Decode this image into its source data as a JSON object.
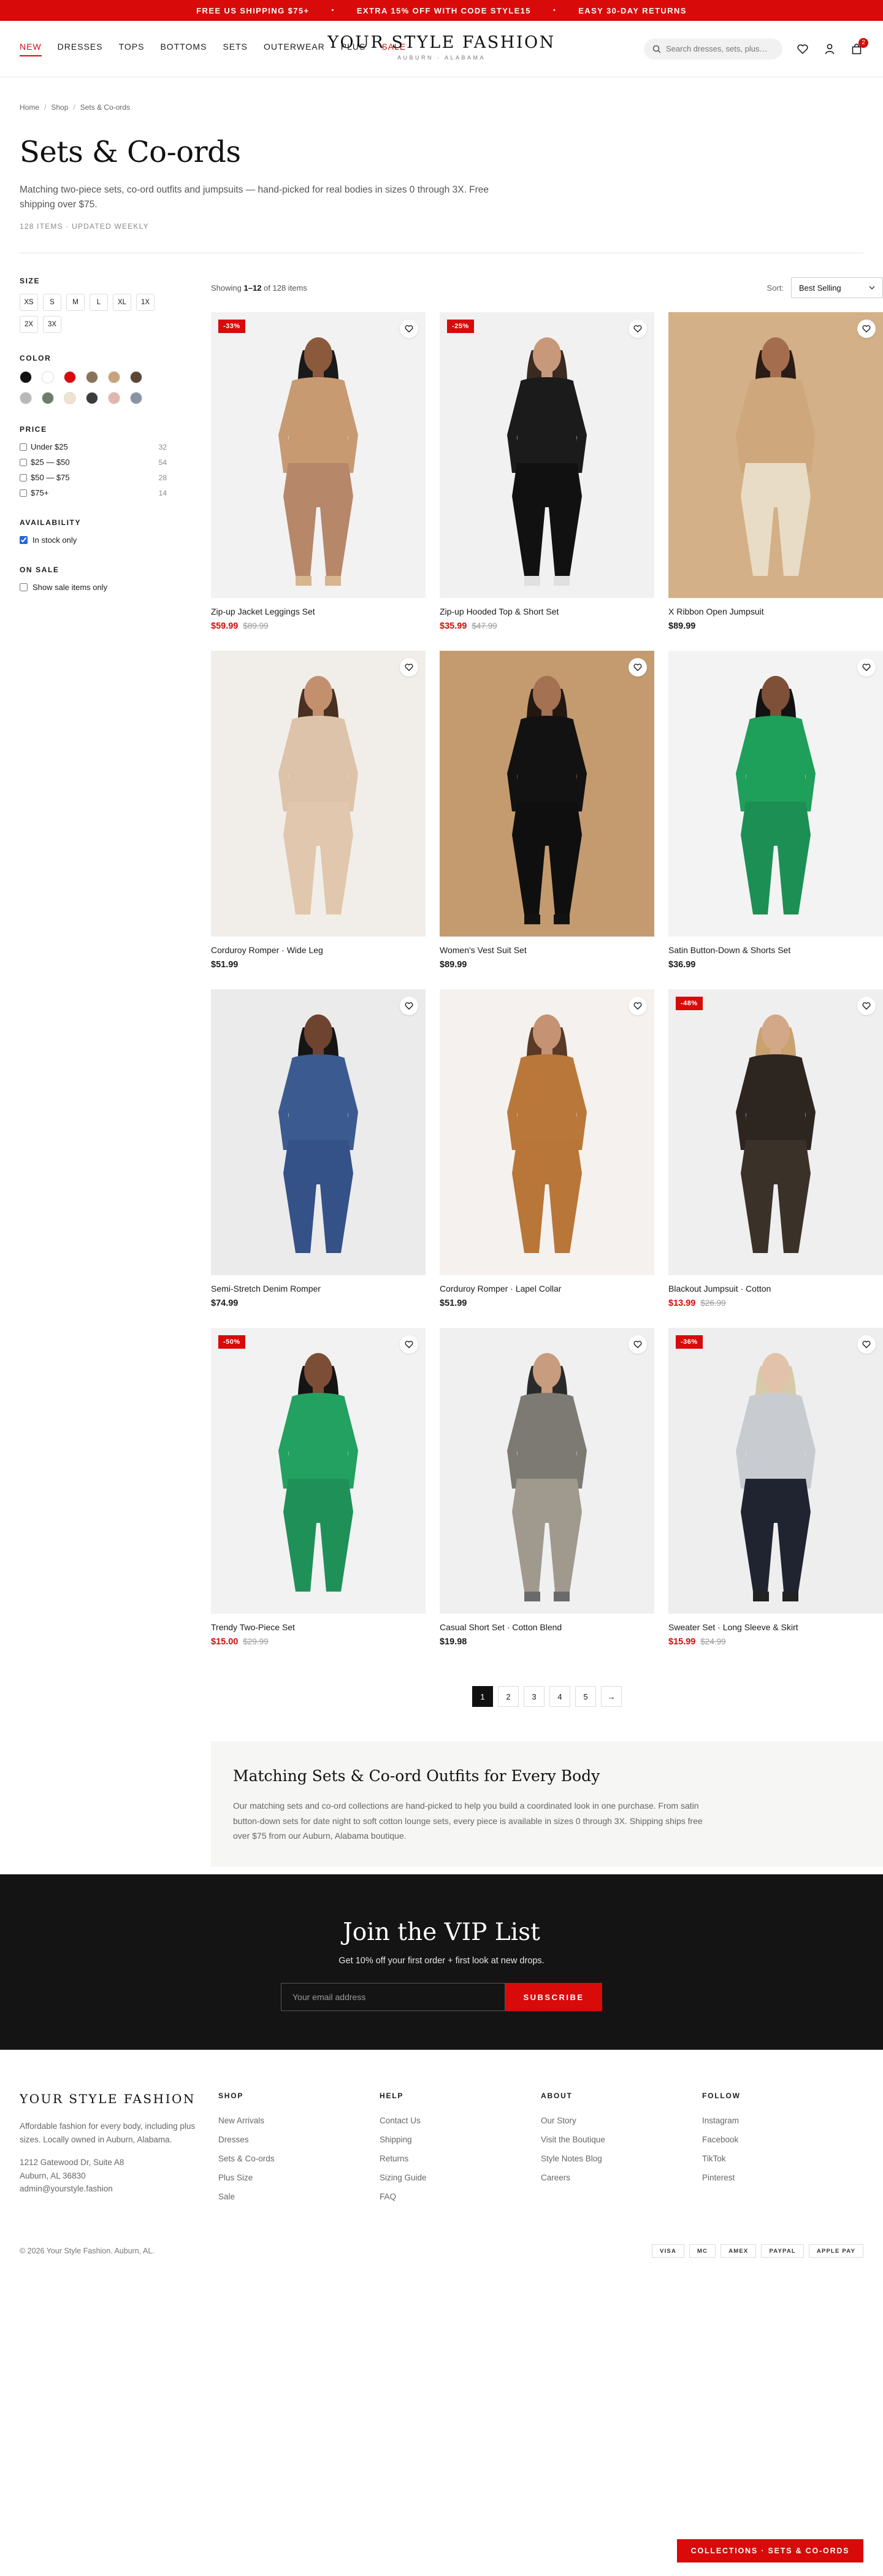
{
  "announcement": {
    "items": [
      "FREE US SHIPPING $75+",
      "EXTRA 15% OFF WITH CODE STYLE15",
      "EASY 30-DAY RETURNS"
    ],
    "separator": "•"
  },
  "header": {
    "nav": [
      {
        "label": "NEW",
        "active": true,
        "red": true
      },
      {
        "label": "DRESSES"
      },
      {
        "label": "TOPS"
      },
      {
        "label": "BOTTOMS"
      },
      {
        "label": "SETS"
      },
      {
        "label": "OUTERWEAR"
      },
      {
        "label": "PLUS"
      },
      {
        "label": "SALE",
        "red": true
      }
    ],
    "logo": "YOUR STYLE FASHION",
    "logo_sub": "AUBURN · ALABAMA",
    "search_placeholder": "Search dresses, sets, plus…",
    "cart_count": "2",
    "icons": [
      "search-icon",
      "heart-icon",
      "user-icon",
      "bag-icon"
    ]
  },
  "breadcrumb": {
    "items": [
      "Home",
      "Shop",
      "Sets & Co-ords"
    ],
    "separator": "/"
  },
  "hero": {
    "title": "Sets & Co-ords",
    "description": "Matching two-piece sets, co-ord outfits and jumpsuits — hand-picked for real bodies in sizes 0 through 3X. Free shipping over $75.",
    "meta": "128 ITEMS · UPDATED WEEKLY"
  },
  "filters": {
    "size_title": "SIZE",
    "sizes": [
      "XS",
      "S",
      "M",
      "L",
      "XL",
      "1X",
      "2X",
      "3X"
    ],
    "color_title": "COLOR",
    "colors": [
      "#111111",
      "#ffffff",
      "#d90a0a",
      "#8a7358",
      "#c9a27c",
      "#5b4636",
      "#b9b9b9",
      "#6b7d6b",
      "#efe3cf",
      "#3b3b3b",
      "#e0b7ad",
      "#8894a3"
    ],
    "price_title": "PRICE",
    "prices": [
      {
        "label": "Under $25",
        "count": "32"
      },
      {
        "label": "$25 — $50",
        "count": "54"
      },
      {
        "label": "$50 — $75",
        "count": "28"
      },
      {
        "label": "$75+",
        "count": "14"
      }
    ],
    "availability_title": "AVAILABILITY",
    "availability_label": "In stock only",
    "availability_checked": true,
    "sale_title": "ON SALE",
    "sale_label": "Show sale items only",
    "sale_checked": false
  },
  "toolbar": {
    "showing_prefix": "Showing",
    "showing_range": "1–12",
    "showing_suffix": "of 128 items",
    "sort_label": "Sort:",
    "sort_value": "Best Selling"
  },
  "products": [
    {
      "name": "Zip-up Jacket Leggings Set",
      "price": "$59.99",
      "original": "$89.99",
      "discount": "-33%",
      "bg": "#f2f2f2",
      "palette": {
        "top": "#c89a72",
        "bottom": "#b7876a",
        "skin": "#8b5a3c",
        "hair": "#1a1a1a",
        "shoe": "#d7b58f"
      }
    },
    {
      "name": "Zip-up Hooded Top & Short Set",
      "price": "$35.99",
      "original": "$47.99",
      "discount": "-25%",
      "bg": "#f1f1f1",
      "palette": {
        "top": "#1b1b1b",
        "bottom": "#111111",
        "skin": "#c8987a",
        "hair": "#3a2a20",
        "shoe": "#e0e0e0"
      }
    },
    {
      "name": "X Ribbon Open Jumpsuit",
      "price": "$89.99",
      "original": "",
      "discount": "",
      "bg": "#d3b087",
      "palette": {
        "top": "#cfa77d",
        "bottom": "#e9dcc7",
        "skin": "#a46e4e",
        "hair": "#2a1c16",
        "shoe": "#d3b087"
      }
    },
    {
      "name": "Corduroy Romper · Wide Leg",
      "price": "$51.99",
      "original": "",
      "discount": "",
      "bg": "#f1eeea",
      "palette": {
        "top": "#ddc3a9",
        "bottom": "#e0c7ad",
        "skin": "#c3906f",
        "hair": "#4a3020",
        "shoe": "#f1eeea"
      }
    },
    {
      "name": "Women's Vest Suit Set",
      "price": "$89.99",
      "original": "",
      "discount": "",
      "bg": "#c49b6f",
      "palette": {
        "top": "#121212",
        "bottom": "#0f0f0f",
        "skin": "#a47152",
        "hair": "#221711",
        "shoe": "#121212"
      }
    },
    {
      "name": "Satin Button-Down & Shorts Set",
      "price": "$36.99",
      "original": "",
      "discount": "",
      "bg": "#f3f3f3",
      "palette": {
        "top": "#1e9f5a",
        "bottom": "#1c8f55",
        "skin": "#7e5037",
        "hair": "#121212",
        "shoe": "#f3f3f3"
      }
    },
    {
      "name": "Semi-Stretch Denim Romper",
      "price": "$74.99",
      "original": "",
      "discount": "",
      "bg": "#ebebeb",
      "palette": {
        "top": "#3b5a8f",
        "bottom": "#345188",
        "skin": "#6e4330",
        "hair": "#151515",
        "shoe": "#ebebeb"
      }
    },
    {
      "name": "Corduroy Romper · Lapel Collar",
      "price": "$51.99",
      "original": "",
      "discount": "",
      "bg": "#f4f1ee",
      "palette": {
        "top": "#b9773a",
        "bottom": "#b87638",
        "skin": "#c59274",
        "hair": "#5a3a26",
        "shoe": "#f4f1ee"
      }
    },
    {
      "name": "Blackout Jumpsuit · Cotton",
      "price": "$13.99",
      "original": "$26.99",
      "discount": "-48%",
      "bg": "#efefef",
      "palette": {
        "top": "#2d2620",
        "bottom": "#3a3129",
        "skin": "#d3a888",
        "hair": "#c9a26e",
        "shoe": "#efefef"
      }
    },
    {
      "name": "Trendy Two-Piece Set",
      "price": "$15.00",
      "original": "$29.99",
      "discount": "-50%",
      "bg": "#f2f2f2",
      "palette": {
        "top": "#22a160",
        "bottom": "#1f9158",
        "skin": "#7c4e36",
        "hair": "#141414",
        "shoe": "#f2f2f2"
      }
    },
    {
      "name": "Casual Short Set · Cotton Blend",
      "price": "$19.98",
      "original": "",
      "discount": "",
      "bg": "#f0f0f0",
      "palette": {
        "top": "#7d7a74",
        "bottom": "#a09a8e",
        "skin": "#c89c7f",
        "hair": "#2a2a2a",
        "shoe": "#6a6a6a"
      }
    },
    {
      "name": "Sweater Set · Long Sleeve & Skirt",
      "price": "$15.99",
      "original": "$24.99",
      "discount": "-36%",
      "bg": "#eeeeee",
      "palette": {
        "top": "#c8cbd0",
        "bottom": "#1f2430",
        "skin": "#e3c2ab",
        "hair": "#d8c9a8",
        "shoe": "#222222"
      }
    }
  ],
  "pagination": {
    "pages": [
      "1",
      "2",
      "3",
      "4",
      "5"
    ],
    "next": "→",
    "current": "1"
  },
  "seo": {
    "title": "Matching Sets & Co-ord Outfits for Every Body",
    "body": "Our matching sets and co-ord collections are hand-picked to help you build a coordinated look in one purchase. From satin button-down sets for date night to soft cotton lounge sets, every piece is available in sizes 0 through 3X. Shipping ships free over $75 from our Auburn, Alabama boutique."
  },
  "vip": {
    "title": "Join the VIP List",
    "subtitle": "Get 10% off your first order + first look at new drops.",
    "placeholder": "Your email address",
    "button": "SUBSCRIBE"
  },
  "footer": {
    "logo": "YOUR STYLE FASHION",
    "tagline": "Affordable fashion for every body, including plus sizes. Locally owned in Auburn, Alabama.",
    "address": [
      "1212 Gatewood Dr, Suite A8",
      "Auburn, AL 36830",
      "admin@yourstyle.fashion"
    ],
    "columns": [
      {
        "title": "SHOP",
        "links": [
          "New Arrivals",
          "Dresses",
          "Sets & Co-ords",
          "Plus Size",
          "Sale"
        ]
      },
      {
        "title": "HELP",
        "links": [
          "Contact Us",
          "Shipping",
          "Returns",
          "Sizing Guide",
          "FAQ"
        ]
      },
      {
        "title": "ABOUT",
        "links": [
          "Our Story",
          "Visit the Boutique",
          "Style Notes Blog",
          "Careers"
        ]
      },
      {
        "title": "FOLLOW",
        "links": [
          "Instagram",
          "Facebook",
          "TikTok",
          "Pinterest"
        ]
      }
    ],
    "copyright": "© 2026 Your Style Fashion. Auburn, AL.",
    "payments": [
      "VISA",
      "MC",
      "AMEX",
      "PAYPAL",
      "APPLE PAY"
    ]
  },
  "sticky_label": "COLLECTIONS · SETS & CO-ORDS"
}
